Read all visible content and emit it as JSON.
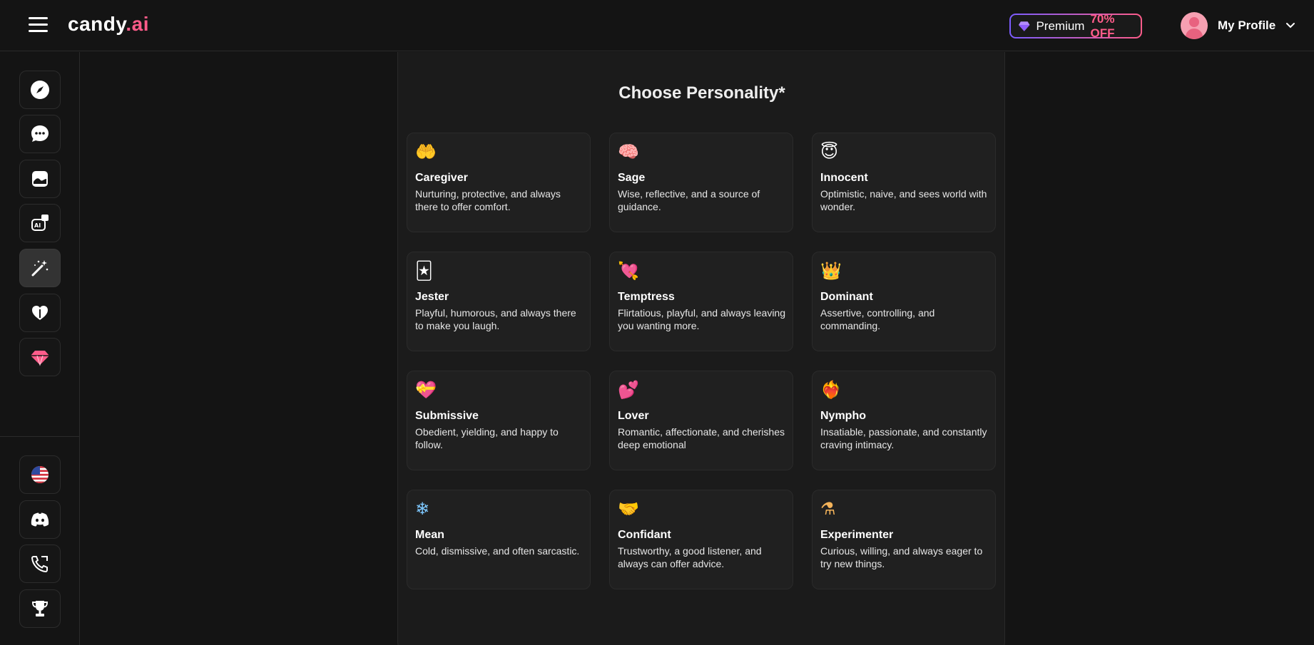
{
  "header": {
    "logo_main": "candy",
    "logo_ai": ".ai",
    "premium_label": "Premium",
    "premium_discount": "70% OFF",
    "profile_label": "My Profile"
  },
  "sidebar": {
    "items": [
      {
        "name": "explore",
        "icon": "compass-icon"
      },
      {
        "name": "chat",
        "icon": "chat-bubble-icon"
      },
      {
        "name": "gallery",
        "icon": "image-icon"
      },
      {
        "name": "generate-image",
        "icon": "ai-camera-icon"
      },
      {
        "name": "create-character",
        "icon": "magic-wand-icon"
      },
      {
        "name": "my-ai",
        "icon": "heart-hands-icon"
      },
      {
        "name": "premium",
        "icon": "diamond-icon"
      }
    ],
    "bottom_items": [
      {
        "name": "language",
        "icon": "us-flag-icon"
      },
      {
        "name": "discord",
        "icon": "discord-icon"
      },
      {
        "name": "support",
        "icon": "phone-icon"
      },
      {
        "name": "leaderboard",
        "icon": "trophy-icon"
      }
    ]
  },
  "main": {
    "title": "Choose Personality*",
    "personalities": [
      {
        "emoji": "🤲",
        "name": "Caregiver",
        "description": "Nurturing, protective, and always there to offer comfort."
      },
      {
        "emoji": "🧠",
        "name": "Sage",
        "description": "Wise, reflective, and a source of guidance."
      },
      {
        "emoji": "😇",
        "name": "Innocent",
        "description": "Optimistic, naive, and sees world with wonder."
      },
      {
        "emoji": "🃏",
        "name": "Jester",
        "description": "Playful, humorous, and always there to make you laugh."
      },
      {
        "emoji": "💘",
        "name": "Temptress",
        "description": "Flirtatious, playful, and always leaving you wanting more."
      },
      {
        "emoji": "👑",
        "name": "Dominant",
        "description": "Assertive, controlling, and commanding."
      },
      {
        "emoji": "💝",
        "name": "Submissive",
        "description": "Obedient, yielding, and happy to follow."
      },
      {
        "emoji": "💕",
        "name": "Lover",
        "description": "Romantic, affectionate, and cherishes deep emotional"
      },
      {
        "emoji": "❤️‍🔥",
        "name": "Nympho",
        "description": "Insatiable, passionate, and constantly craving intimacy."
      },
      {
        "emoji": "❄",
        "name": "Mean",
        "description": "Cold, dismissive, and often sarcastic."
      },
      {
        "emoji": "🤝",
        "name": "Confidant",
        "description": "Trustworthy, a good listener, and always can offer advice."
      },
      {
        "emoji": "⚗",
        "name": "Experimenter",
        "description": "Curious, willing, and always eager to try new things."
      }
    ]
  },
  "colors": {
    "accent": "#ff5c8a",
    "premium_gradient_start": "#7b5cff",
    "background": "#141414",
    "card": "#202020"
  }
}
